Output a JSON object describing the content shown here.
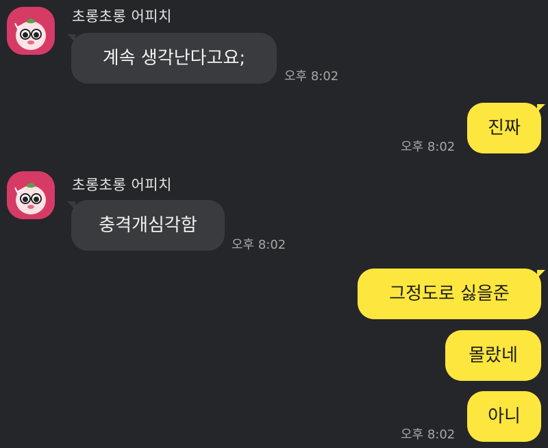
{
  "sender_name": "초롱초롱 어피치",
  "messages": [
    {
      "side": "in",
      "text": "계속 생각난다고요;",
      "time": "오후 8:02"
    },
    {
      "side": "out",
      "text": "진짜",
      "time": "오후 8:02"
    },
    {
      "side": "in",
      "text": "충격개심각함",
      "time": "오후 8:02"
    },
    {
      "side": "out",
      "text": "그정도로 싫을준",
      "time": ""
    },
    {
      "side": "out",
      "text": "몰랐네",
      "time": ""
    },
    {
      "side": "out",
      "text": "아니",
      "time": "오후 8:02"
    }
  ],
  "avatar_icon": "apeach-character-icon",
  "colors": {
    "background": "#252629",
    "incoming_bubble": "#3a3b3f",
    "outgoing_bubble": "#fde73e",
    "avatar_bg": "#d63b66"
  }
}
